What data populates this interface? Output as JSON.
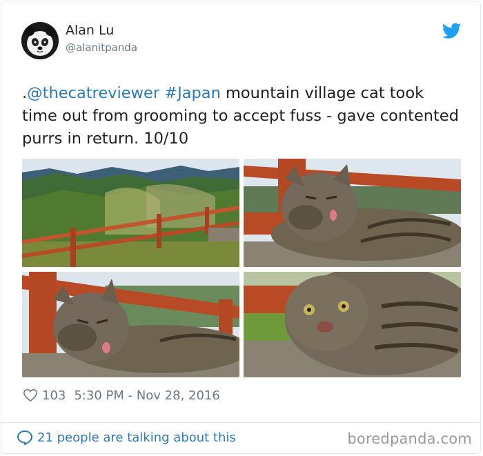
{
  "author": {
    "name": "Alan Lu",
    "handle": "@alanitpanda",
    "avatar_icon": "panda-avatar"
  },
  "tweet": {
    "prefix": ".",
    "mention": "@thecatreviewer",
    "hashtag": "#Japan",
    "body": " mountain village cat took time out from grooming to accept fuss - gave contented purrs in return. 10/10"
  },
  "photos": [
    {
      "name": "mountain-village-photo"
    },
    {
      "name": "cat-grooming-photo-1"
    },
    {
      "name": "cat-grooming-photo-2"
    },
    {
      "name": "cat-closeup-photo"
    }
  ],
  "meta": {
    "likes": "103",
    "timestamp": "5:30 PM - Nov 28, 2016"
  },
  "footer": {
    "talking": "21 people are talking about this",
    "watermark": "boredpanda.com"
  },
  "colors": {
    "link": "#2b7bb9",
    "twitter_blue": "#1da1f2",
    "muted": "#697882",
    "border": "#e1e8ed"
  }
}
